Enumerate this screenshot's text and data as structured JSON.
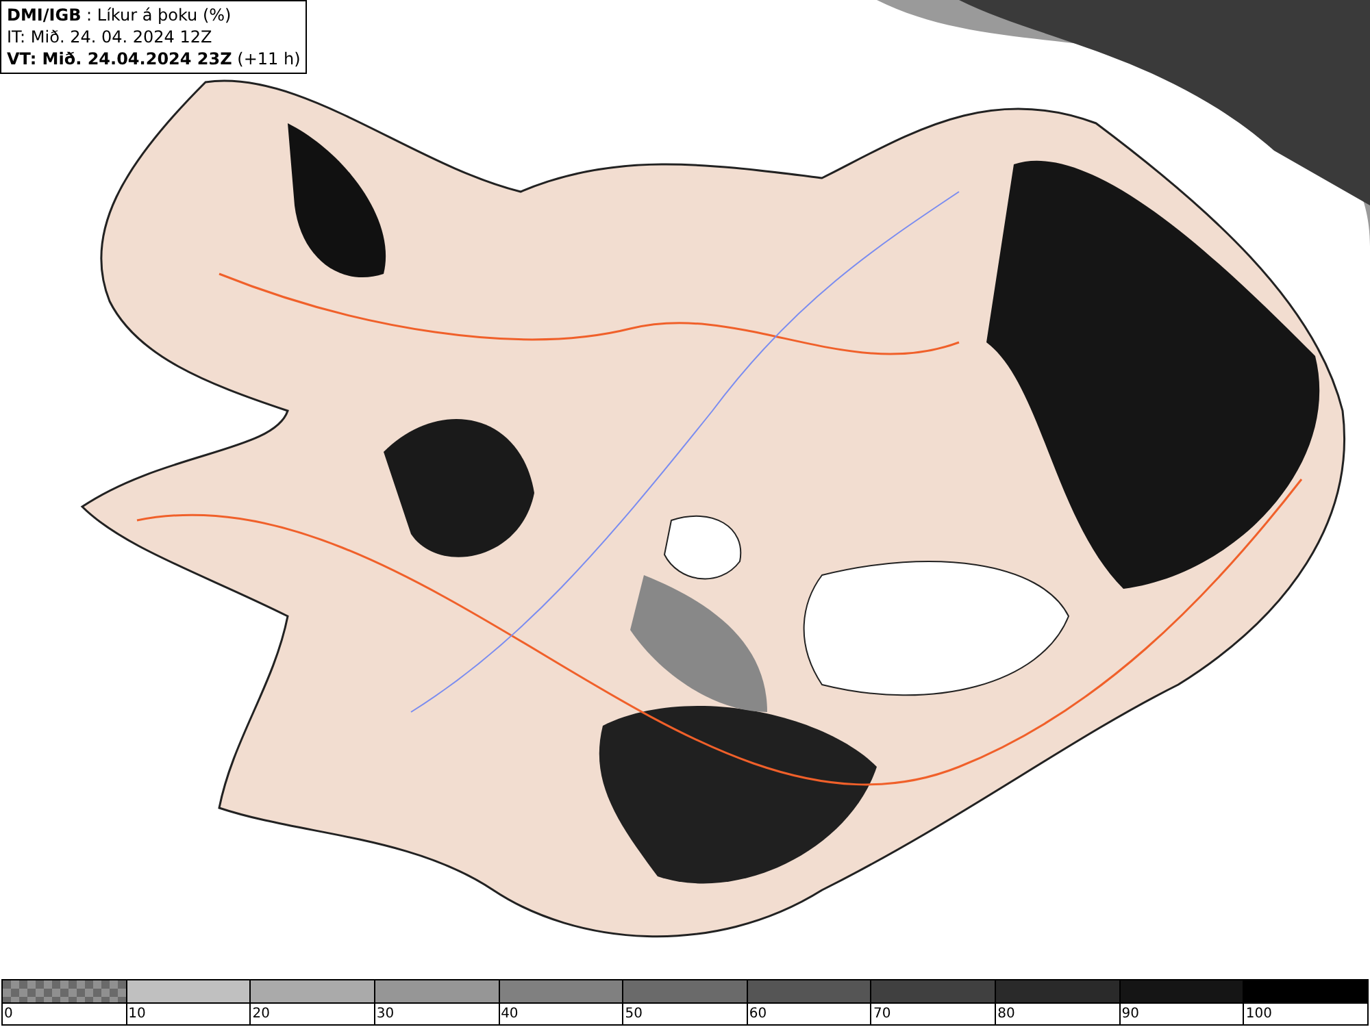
{
  "header": {
    "lines": [
      "**DMI/IGB** : Líkur á þoku (%)",
      "IT: Mið. 24. 04. 2024 12Z",
      "**VT: Mið. 24.04.2024 23Z** (+11 h)"
    ]
  },
  "legend": {
    "segments": [
      {
        "label": "0",
        "color": "#909090",
        "kind": "checkered"
      },
      {
        "label": "10",
        "color": "#c0c0c0",
        "kind": "solid"
      },
      {
        "label": "20",
        "color": "#aaaaaa",
        "kind": "solid"
      },
      {
        "label": "30",
        "color": "#969696",
        "kind": "solid"
      },
      {
        "label": "40",
        "color": "#808080",
        "kind": "solid"
      },
      {
        "label": "50",
        "color": "#6a6a6a",
        "kind": "solid"
      },
      {
        "label": "60",
        "color": "#555555",
        "kind": "solid"
      },
      {
        "label": "70",
        "color": "#404040",
        "kind": "solid"
      },
      {
        "label": "80",
        "color": "#2a2a2a",
        "kind": "solid"
      },
      {
        "label": "90",
        "color": "#151515",
        "kind": "solid"
      },
      {
        "label": "100",
        "color": "#000000",
        "kind": "solid"
      }
    ]
  }
}
